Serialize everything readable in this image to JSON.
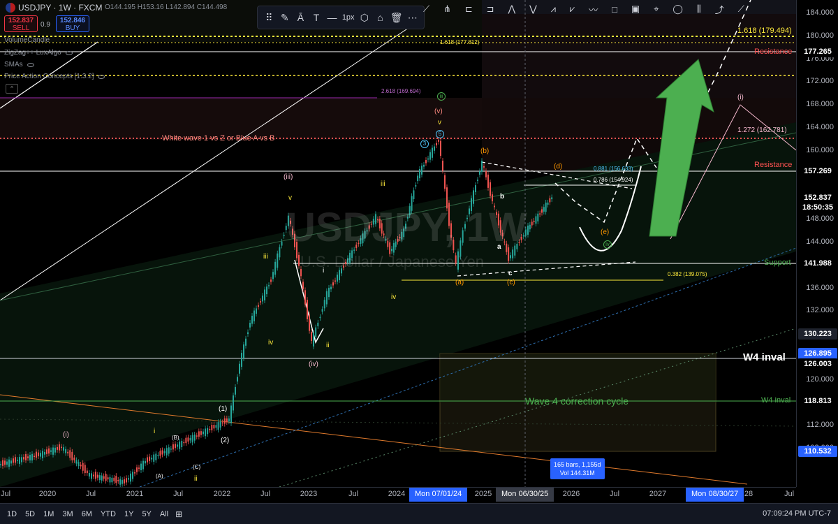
{
  "header": {
    "symbol": "USDJPY · 1W · FXCM",
    "ohlc_text": "O144.195 H153.16 L142.894 C144.498",
    "sell_price": "152.837",
    "sell_label": "SELL",
    "spread": "0.9",
    "buy_price": "152.846",
    "buy_label": "BUY",
    "indicators": [
      "VolumeCandle",
      "ZigZag++ LuxAlgo",
      "SMAs",
      "Price Action Concepts [1.3.2]"
    ]
  },
  "drawing_toolbar": {
    "width_label": "1px",
    "icons": [
      "drag-handle-icon",
      "pencil-icon",
      "text-color-icon",
      "text-icon",
      "line-style-icon",
      "settings-icon",
      "lock-icon",
      "trash-icon",
      "more-icon"
    ]
  },
  "watermark": {
    "symbol": "USDJPY, 1W",
    "description": "U.S. Dollar / Japanese Yen"
  },
  "price_axis": {
    "ticks": [
      "184.000",
      "180.000",
      "176.000",
      "172.000",
      "168.000",
      "164.000",
      "160.000",
      "156.000",
      "152.000",
      "148.000",
      "144.000",
      "140.000",
      "136.000",
      "132.000",
      "128.000",
      "124.000",
      "120.000",
      "116.000",
      "112.000",
      "108.000"
    ],
    "labels": [
      {
        "text": "177.265",
        "color": "#ffffff",
        "bg": "#000000"
      },
      {
        "text": "157.269",
        "color": "#ffffff",
        "bg": "#000000"
      },
      {
        "text": "152.837",
        "color": "#ffffff",
        "bg": "#000000"
      },
      {
        "text": "18:50:35",
        "color": "#ffffff",
        "bg": "#000000"
      },
      {
        "text": "141.988",
        "color": "#ffffff",
        "bg": "#000000"
      },
      {
        "text": "130.223",
        "color": "#ffffff",
        "bg": "#1e222d"
      },
      {
        "text": "126.895",
        "color": "#ffffff",
        "bg": "#2962ff"
      },
      {
        "text": "126.003",
        "color": "#ffffff",
        "bg": "#000000"
      },
      {
        "text": "118.813",
        "color": "#ffffff",
        "bg": "#000000"
      },
      {
        "text": "110.532",
        "color": "#ffffff",
        "bg": "#2962ff"
      }
    ]
  },
  "time_axis": {
    "ticks": [
      "Jul",
      "2020",
      "Jul",
      "2021",
      "Jul",
      "2022",
      "Jul",
      "2023",
      "Jul",
      "2024",
      "2025",
      "2026",
      "Jul",
      "2027",
      "28",
      "Jul"
    ],
    "highlights": [
      "Mon 07/01/24",
      "Mon 06/30/25",
      "Mon 08/30/27"
    ]
  },
  "annotations": {
    "fib_1618_top": "1.618 (179.494)",
    "fib_1618": "1.618 (177.812)",
    "resistance_top": "Resistance",
    "fib_2618": "2.618 (169.694)",
    "white_wave": "White wave 1 vs Z or Blue A vs B",
    "fib_1272": "1.272 (162.781)",
    "fib_0881": "0.881 (156.633)",
    "fib_0786": "0.786 (154.924)",
    "resistance_mid": "Resistance",
    "support": "Support",
    "fib_0382": "0.382 (139.075)",
    "w4_inval_big": "W4 inval",
    "w4_inval_small": "W4 inval",
    "wave4_cycle": "Wave 4 correction cycle",
    "measure_bars": "165 bars, 1,155d",
    "measure_vol": "Vol 144.31M"
  },
  "wave_labels": {
    "iii_circle": "iii",
    "v_paren": "(v)",
    "v_small": "v",
    "five_c": "5",
    "three_c": "3",
    "b_paren": "(b)",
    "d_paren": "(d)",
    "e_paren": "(e)",
    "iv_circle": "iv",
    "i_paren_right": "(i)",
    "iii_paren": "(iii)",
    "iv_paren": "(iv)",
    "a_paren": "(a)",
    "c_paren": "(c)",
    "b_small": "b",
    "a_small": "a",
    "c_small": "c",
    "iii_y": "iii",
    "v_y": "v",
    "iv_y": "iv",
    "i_w": "i",
    "ii_y": "ii",
    "iv_y2": "iv",
    "iii_y2": "iii",
    "i_paren_left": "(i)",
    "one_paren": "(1)",
    "two_paren": "(2)",
    "a_cap": "(A)",
    "b_cap": "(B)",
    "c_cap": "(C)",
    "i_left": "i",
    "ii_left": "ii"
  },
  "bottom_bar": {
    "timeframes": [
      "1D",
      "5D",
      "1M",
      "3M",
      "6M",
      "YTD",
      "1Y",
      "5Y",
      "All"
    ],
    "clock": "07:09:24 PM UTC-7"
  },
  "colors": {
    "bull": "#26a69a",
    "bear": "#ef5350",
    "resistance": "#ff5252",
    "support": "#4caf50",
    "fib_yellow": "#ffeb3b",
    "accent": "#2962ff"
  }
}
